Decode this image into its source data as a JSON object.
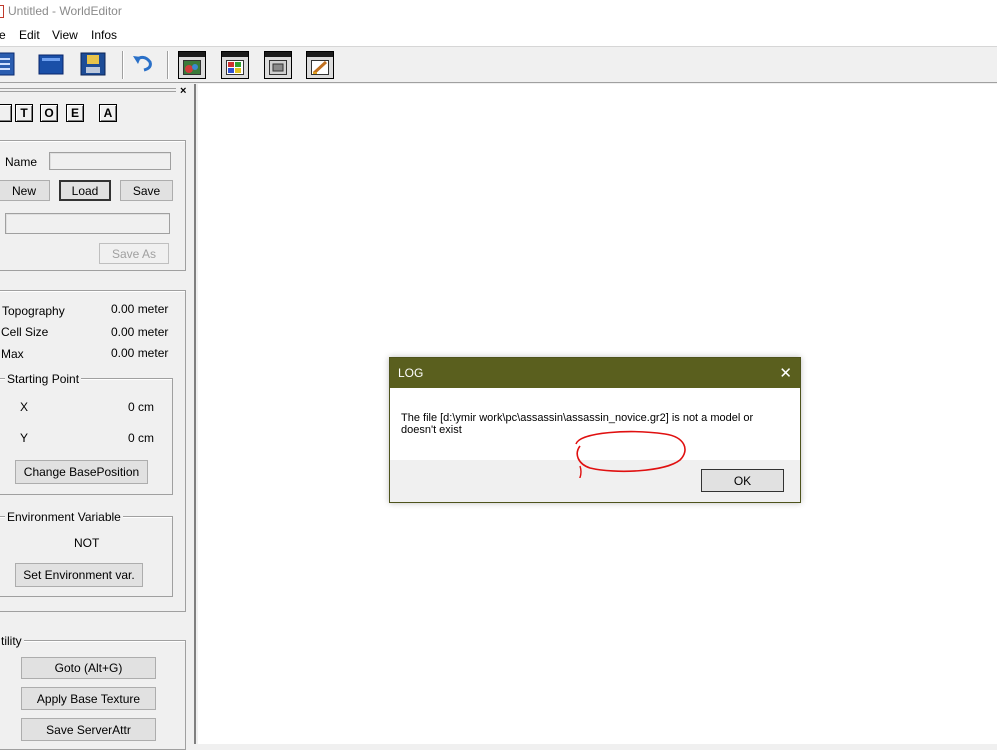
{
  "window": {
    "title": "Untitled - WorldEditor"
  },
  "menu": {
    "items": [
      "e",
      "Edit",
      "View",
      "Infos"
    ]
  },
  "toolbar": {
    "buttons": [
      "new-doc-icon",
      "open-folder-icon",
      "save-disk-icon",
      "undo-icon",
      "object-window-icon",
      "texture-window-icon",
      "map-window-icon",
      "brush-window-icon"
    ]
  },
  "left_panel": {
    "tabs": [
      "",
      "T",
      "O",
      "E",
      "A"
    ],
    "name_label": "Name",
    "name_value": "",
    "new_label": "New",
    "load_label": "Load",
    "save_label": "Save",
    "path_value": "",
    "save_as_label": "Save As",
    "topography_label": "Topography",
    "topography_value": "0.00 meter",
    "cell_size_label": "Cell Size",
    "cell_size_value": "0.00 meter",
    "max_label": "Max",
    "max_value": "0.00 meter",
    "starting_point": {
      "title": "Starting Point",
      "x_label": "X",
      "x_value": "0 cm",
      "y_label": "Y",
      "y_value": "0 cm",
      "change_label": "Change BasePosition"
    },
    "environment": {
      "title": "Environment Variable",
      "value": "NOT",
      "set_label": "Set Environment var."
    },
    "utility": {
      "title": "tility",
      "goto_label": "Goto (Alt+G)",
      "apply_texture_label": "Apply Base Texture",
      "save_server_label": "Save ServerAttr"
    }
  },
  "dialog": {
    "title": "LOG",
    "message_line1": "The file [d:\\ymir work\\pc\\assassin\\assassin_novice.gr2] is not a model or",
    "message_line2": "doesn't exist",
    "ok_label": "OK"
  },
  "colors": {
    "dialog_title_bg": "#5a5f1e",
    "annotation_red": "#e01010"
  }
}
